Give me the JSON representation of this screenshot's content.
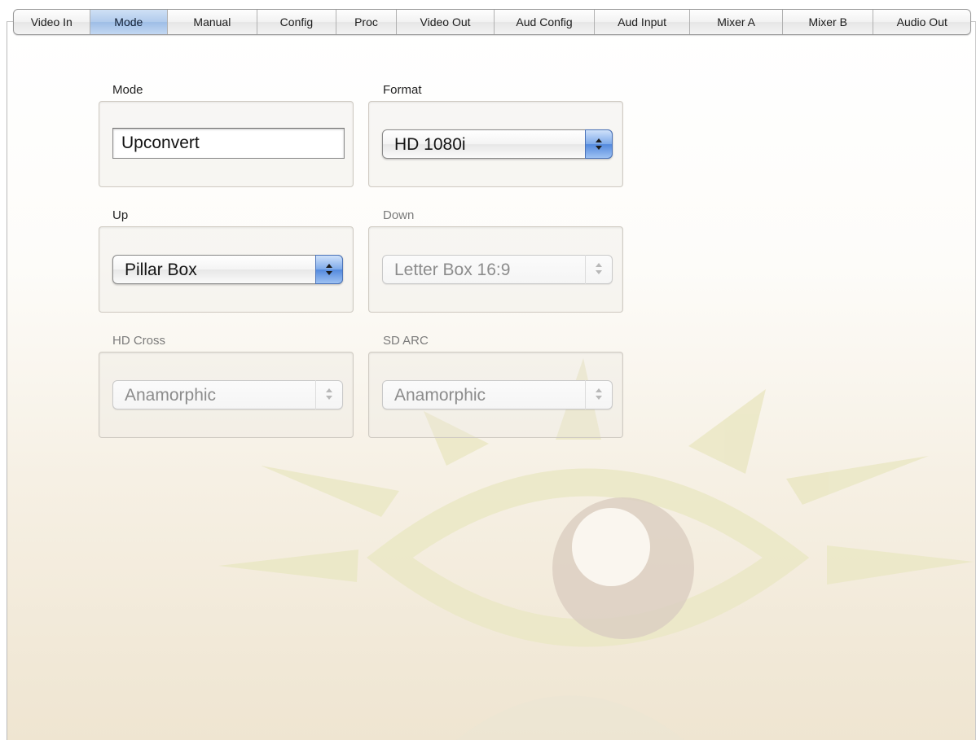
{
  "tabs": [
    {
      "label": "Video In",
      "active": false
    },
    {
      "label": "Mode",
      "active": true
    },
    {
      "label": "Manual",
      "active": false
    },
    {
      "label": "Config",
      "active": false
    },
    {
      "label": "Proc",
      "active": false
    },
    {
      "label": "Video Out",
      "active": false
    },
    {
      "label": "Aud Config",
      "active": false
    },
    {
      "label": "Aud Input",
      "active": false
    },
    {
      "label": "Mixer A",
      "active": false
    },
    {
      "label": "Mixer B",
      "active": false
    },
    {
      "label": "Audio Out",
      "active": false
    }
  ],
  "groups": {
    "mode": {
      "label": "Mode",
      "value": "Upconvert"
    },
    "format": {
      "label": "Format",
      "value": "HD 1080i"
    },
    "up": {
      "label": "Up",
      "value": "Pillar Box"
    },
    "down": {
      "label": "Down",
      "value": "Letter Box 16:9"
    },
    "hd_cross": {
      "label": "HD Cross",
      "value": "Anamorphic"
    },
    "sd_arc": {
      "label": "SD ARC",
      "value": "Anamorphic"
    }
  },
  "colors": {
    "active_tab": "#b1cbec",
    "popup_arrow": "#5389dd",
    "watermark_rays": "#e8e6bf",
    "watermark_iris": "#d8ccc0"
  },
  "icons": {
    "popup_arrow": "up-down-arrows-icon",
    "background": "eye-watermark-icon"
  }
}
